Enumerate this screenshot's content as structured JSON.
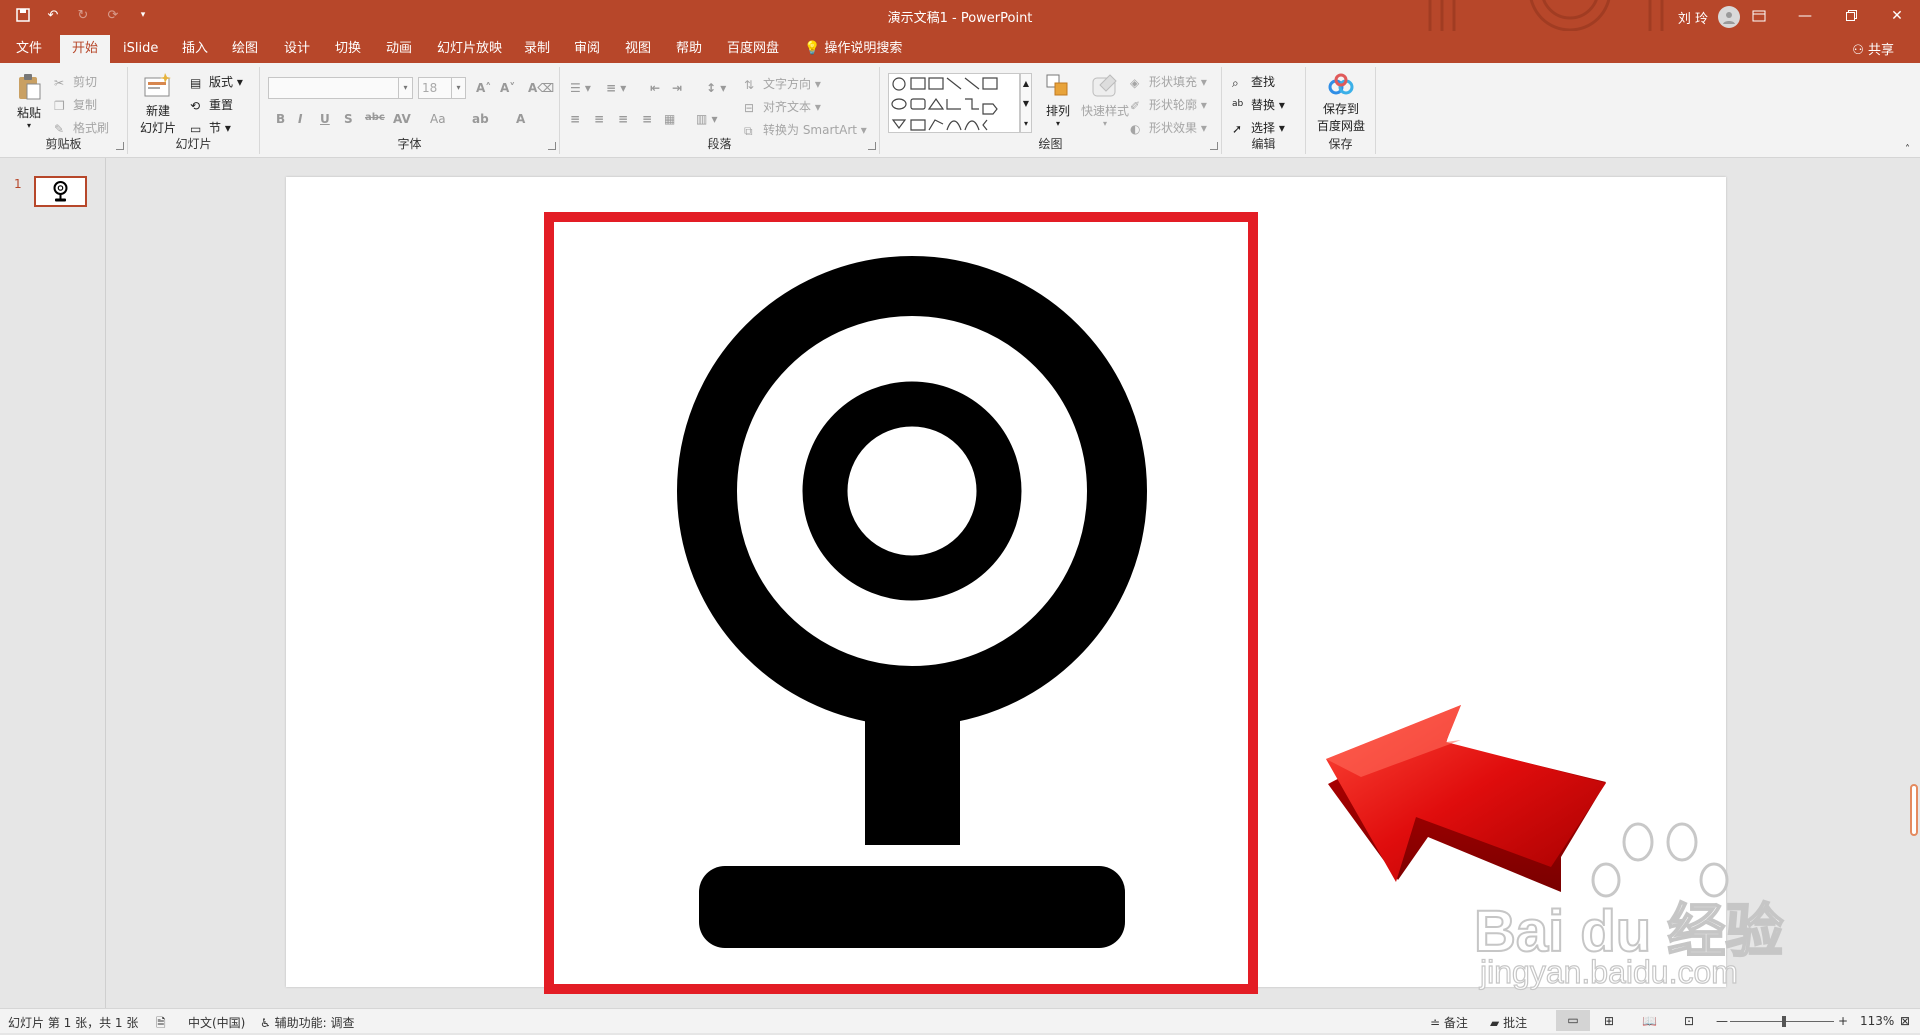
{
  "window": {
    "title": "演示文稿1  -  PowerPoint",
    "user": "刘 玲",
    "controls": [
      "ribbon-display",
      "minimize",
      "restore",
      "close"
    ]
  },
  "qat": [
    "save",
    "undo",
    "redo",
    "repeat",
    "customize"
  ],
  "tabs": [
    "文件",
    "开始",
    "iSlide",
    "插入",
    "绘图",
    "设计",
    "切换",
    "动画",
    "幻灯片放映",
    "录制",
    "审阅",
    "视图",
    "帮助",
    "百度网盘",
    "操作说明搜索"
  ],
  "active_tab": "开始",
  "share": "共享",
  "ribbon": {
    "clipboard": {
      "label": "剪贴板",
      "paste": "粘贴",
      "cut": "剪切",
      "copy": "复制",
      "format_painter": "格式刷"
    },
    "slides": {
      "label": "幻灯片",
      "new_slide_1": "新建",
      "new_slide_2": "幻灯片",
      "layout": "版式",
      "reset": "重置",
      "section": "节"
    },
    "font": {
      "label": "字体",
      "font_size": "18",
      "bold": "B",
      "italic": "I",
      "underline": "U",
      "shadow": "S",
      "strike": "abc",
      "spacing": "AV",
      "case": "Aa",
      "color": "A"
    },
    "paragraph": {
      "label": "段落",
      "text_direction": "文字方向",
      "align_text": "对齐文本",
      "smartart": "转换为 SmartArt"
    },
    "drawing": {
      "label": "绘图",
      "arrange": "排列",
      "quick_styles": "快速样式",
      "shape_fill": "形状填充",
      "shape_outline": "形状轮廓",
      "shape_effects": "形状效果"
    },
    "editing": {
      "label": "编辑",
      "find": "查找",
      "replace": "替换",
      "select": "选择"
    },
    "save": {
      "label": "保存",
      "save_to_1": "保存到",
      "save_to_2": "百度网盘"
    }
  },
  "thumbnails": [
    {
      "number": "1"
    }
  ],
  "status": {
    "slide_info": "幻灯片 第 1 张，共 1 张",
    "language": "中文(中国)",
    "accessibility": "辅助功能: 调查",
    "notes": "备注",
    "comments": "批注",
    "zoom": "113%"
  },
  "colors": {
    "accent": "#b7472a",
    "highlight_frame": "#e31d25",
    "arrow": "#e21818"
  },
  "watermark": {
    "brand": "Bai du 经验",
    "url": "jingyan.baidu.com"
  }
}
